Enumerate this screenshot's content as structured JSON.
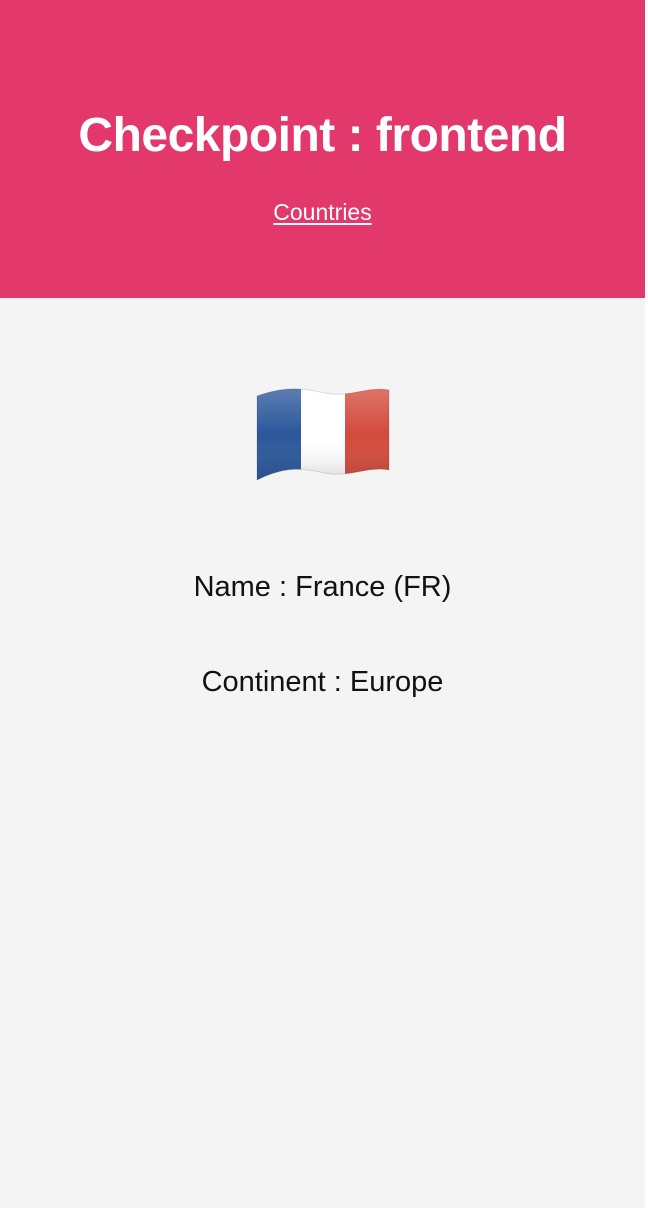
{
  "header": {
    "title": "Checkpoint : frontend",
    "nav_link": "Countries"
  },
  "country": {
    "flag_icon": "france-flag-icon",
    "name_line": "Name : France (FR)",
    "continent_line": "Continent : Europe"
  },
  "colors": {
    "header_bg": "#e3386c",
    "page_bg": "#f4f4f4",
    "flag_blue": "#2b579b",
    "flag_white": "#ffffff",
    "flag_red": "#d34a3c"
  }
}
